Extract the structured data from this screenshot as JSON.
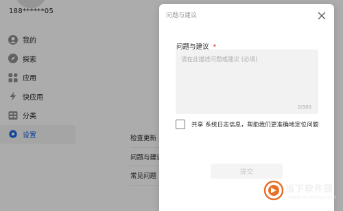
{
  "account": {
    "phone": "188******05"
  },
  "sidebar": {
    "items": [
      {
        "label": "我的",
        "icon": "user-icon"
      },
      {
        "label": "探索",
        "icon": "compass-icon"
      },
      {
        "label": "应用",
        "icon": "apps-icon"
      },
      {
        "label": "快应用",
        "icon": "lightning-icon"
      },
      {
        "label": "分类",
        "icon": "category-icon"
      },
      {
        "label": "设置",
        "icon": "gear-icon",
        "active": true
      }
    ]
  },
  "settings": {
    "items": [
      {
        "label": "检查更新"
      },
      {
        "label": "问题与建议"
      },
      {
        "label": "常见问题"
      }
    ]
  },
  "dialog": {
    "title": "问题与建议",
    "field_label": "问题与建议",
    "required_mark": "*",
    "placeholder": "请在此描述问题或建议 (必填)",
    "counter": "0/300",
    "checkbox_label": "共享 系统日志信息，帮助我们更准确地定位问题",
    "submit_label": "提交"
  },
  "watermark": {
    "name": "当下软件园",
    "url": "www.downxia.com"
  },
  "colors": {
    "accent": "#1763d8",
    "required": "#e02020",
    "overlay": "rgba(0,0,0,0.30)",
    "watermark": "#e8712a"
  }
}
